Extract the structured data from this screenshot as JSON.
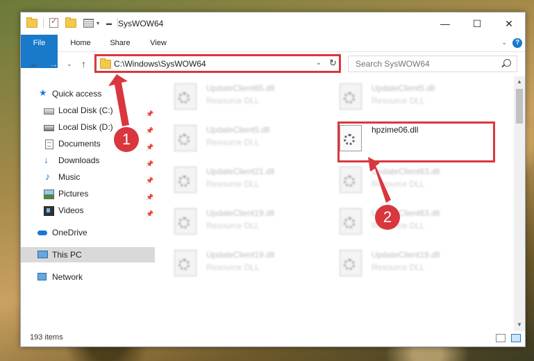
{
  "window": {
    "title": "SysWOW64",
    "minimize": "—",
    "maximize": "☐",
    "close": "✕"
  },
  "ribbon": {
    "tabs": [
      "File",
      "Home",
      "Share",
      "View"
    ],
    "help": "?"
  },
  "address": {
    "path": "C:\\Windows\\SysWOW64",
    "search_placeholder": "Search SysWOW64"
  },
  "nav": {
    "quick_access": "Quick access",
    "items": [
      {
        "label": "Local Disk (C:)",
        "icon": "drive-icon",
        "pinned": true
      },
      {
        "label": "Local Disk (D:)",
        "icon": "drive-icon",
        "pinned": true
      },
      {
        "label": "Documents",
        "icon": "documents-icon",
        "pinned": true
      },
      {
        "label": "Downloads",
        "icon": "download-icon",
        "pinned": true
      },
      {
        "label": "Music",
        "icon": "music-icon",
        "pinned": true
      },
      {
        "label": "Pictures",
        "icon": "pictures-icon",
        "pinned": true
      },
      {
        "label": "Videos",
        "icon": "videos-icon",
        "pinned": true
      }
    ],
    "onedrive": "OneDrive",
    "this_pc": "This PC",
    "network": "Network"
  },
  "files": {
    "items": [
      {
        "name": "UpdateClient65.dll",
        "type": "Resource DLL"
      },
      {
        "name": "UpdateClient5.dll",
        "type": "Resource DLL"
      },
      {
        "name": "UpdateClient5.dll",
        "type": "Resource DLL"
      },
      {
        "name": "hpzime06.dll",
        "type": ""
      },
      {
        "name": "UpdateClient21.dll",
        "type": "Resource DLL"
      },
      {
        "name": "UpdateClient63.dll",
        "type": "Resource DLL"
      },
      {
        "name": "UpdateClient19.dll",
        "type": "Resource DLL"
      },
      {
        "name": "UpdateClient63.dll",
        "type": "Resource DLL"
      },
      {
        "name": "UpdateClient19.dll",
        "type": "Resource DLL"
      },
      {
        "name": "UpdateClient19.dll",
        "type": "Resource DLL"
      }
    ]
  },
  "status": {
    "count": "193 items"
  },
  "annotations": {
    "badge1": "1",
    "badge2": "2",
    "color": "#d9363e"
  }
}
